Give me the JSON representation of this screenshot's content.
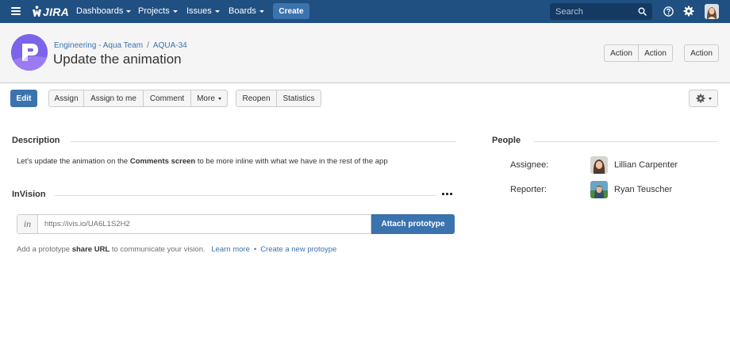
{
  "topnav": {
    "logo_text": "JIRA",
    "items": [
      {
        "label": "Dashboards"
      },
      {
        "label": "Projects"
      },
      {
        "label": "Issues"
      },
      {
        "label": "Boards"
      }
    ],
    "create_label": "Create",
    "search_placeholder": "Search",
    "colors": {
      "bar": "#205081",
      "create": "#3b73af",
      "search_bg": "#143a63"
    }
  },
  "issue": {
    "project": "Engineering - Aqua Team",
    "breadcrumb_sep": "/",
    "key": "AQUA-34",
    "summary": "Update the animation",
    "header_actions": [
      "Action",
      "Action",
      "Action"
    ]
  },
  "toolbar": {
    "edit": "Edit",
    "group1": [
      "Assign",
      "Assign to me",
      "Comment",
      "More"
    ],
    "group2": [
      "Reopen",
      "Statistics"
    ]
  },
  "description": {
    "heading": "Description",
    "text_before": "Let's update the animation on the ",
    "text_bold": "Comments screen",
    "text_after": " to be more inline with what we have in the rest of the app"
  },
  "invision": {
    "heading": "InVision",
    "prefix": "in",
    "url_placeholder": "https://ivis.io/UA6L1S2H2",
    "attach_label": "Attach prototype",
    "help_before": "Add a prototype ",
    "help_bold": "share URL",
    "help_after": " to communicate your vision.",
    "learn_more": "Learn more",
    "link_sep": "•",
    "create_link": "Create a new protoype"
  },
  "people": {
    "heading": "People",
    "assignee_label": "Assignee:",
    "assignee_name": "Lillian Carpenter",
    "reporter_label": "Reporter:",
    "reporter_name": "Ryan Teuscher"
  },
  "icons": {
    "menu": "hamburger-icon",
    "search": "search-icon",
    "help": "help-icon",
    "settings": "gear-icon",
    "more": "ellipsis-icon"
  }
}
